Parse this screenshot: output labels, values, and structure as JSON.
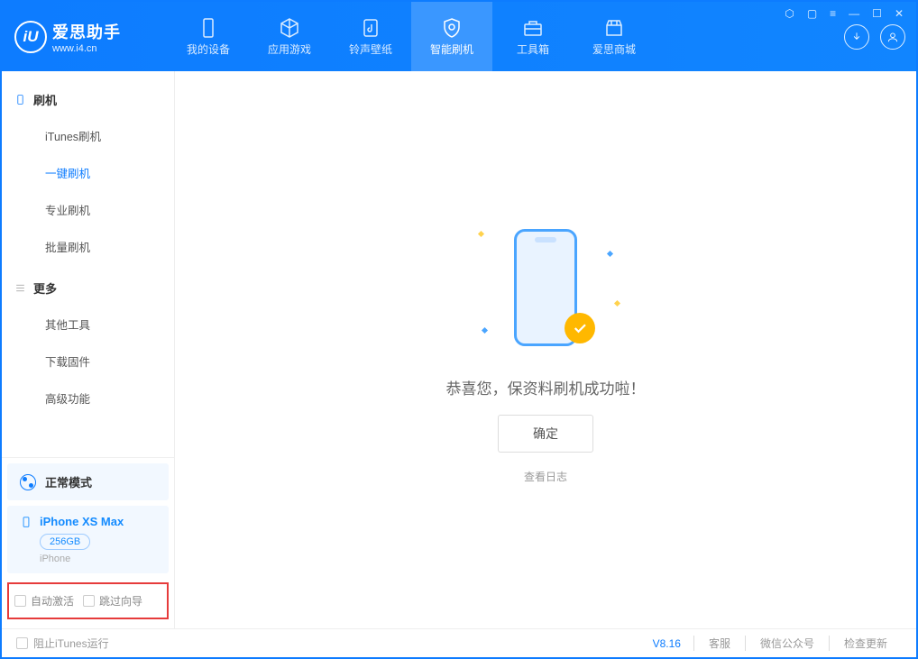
{
  "app": {
    "title": "爱思助手",
    "url": "www.i4.cn"
  },
  "nav": {
    "items": [
      {
        "label": "我的设备",
        "icon": "phone"
      },
      {
        "label": "应用游戏",
        "icon": "cube"
      },
      {
        "label": "铃声壁纸",
        "icon": "music"
      },
      {
        "label": "智能刷机",
        "icon": "shield"
      },
      {
        "label": "工具箱",
        "icon": "toolbox"
      },
      {
        "label": "爱思商城",
        "icon": "store"
      }
    ]
  },
  "sidebar": {
    "group1": {
      "label": "刷机",
      "items": [
        "iTunes刷机",
        "一键刷机",
        "专业刷机",
        "批量刷机"
      ]
    },
    "group2": {
      "label": "更多",
      "items": [
        "其他工具",
        "下载固件",
        "高级功能"
      ]
    },
    "mode": "正常模式",
    "device": {
      "name": "iPhone XS Max",
      "capacity": "256GB",
      "type": "iPhone"
    },
    "checks": {
      "auto_activate": "自动激活",
      "skip_guide": "跳过向导"
    }
  },
  "main": {
    "message": "恭喜您，保资料刷机成功啦！",
    "confirm": "确定",
    "log_link": "查看日志"
  },
  "footer": {
    "block_itunes": "阻止iTunes运行",
    "version": "V8.16",
    "links": [
      "客服",
      "微信公众号",
      "检查更新"
    ]
  }
}
